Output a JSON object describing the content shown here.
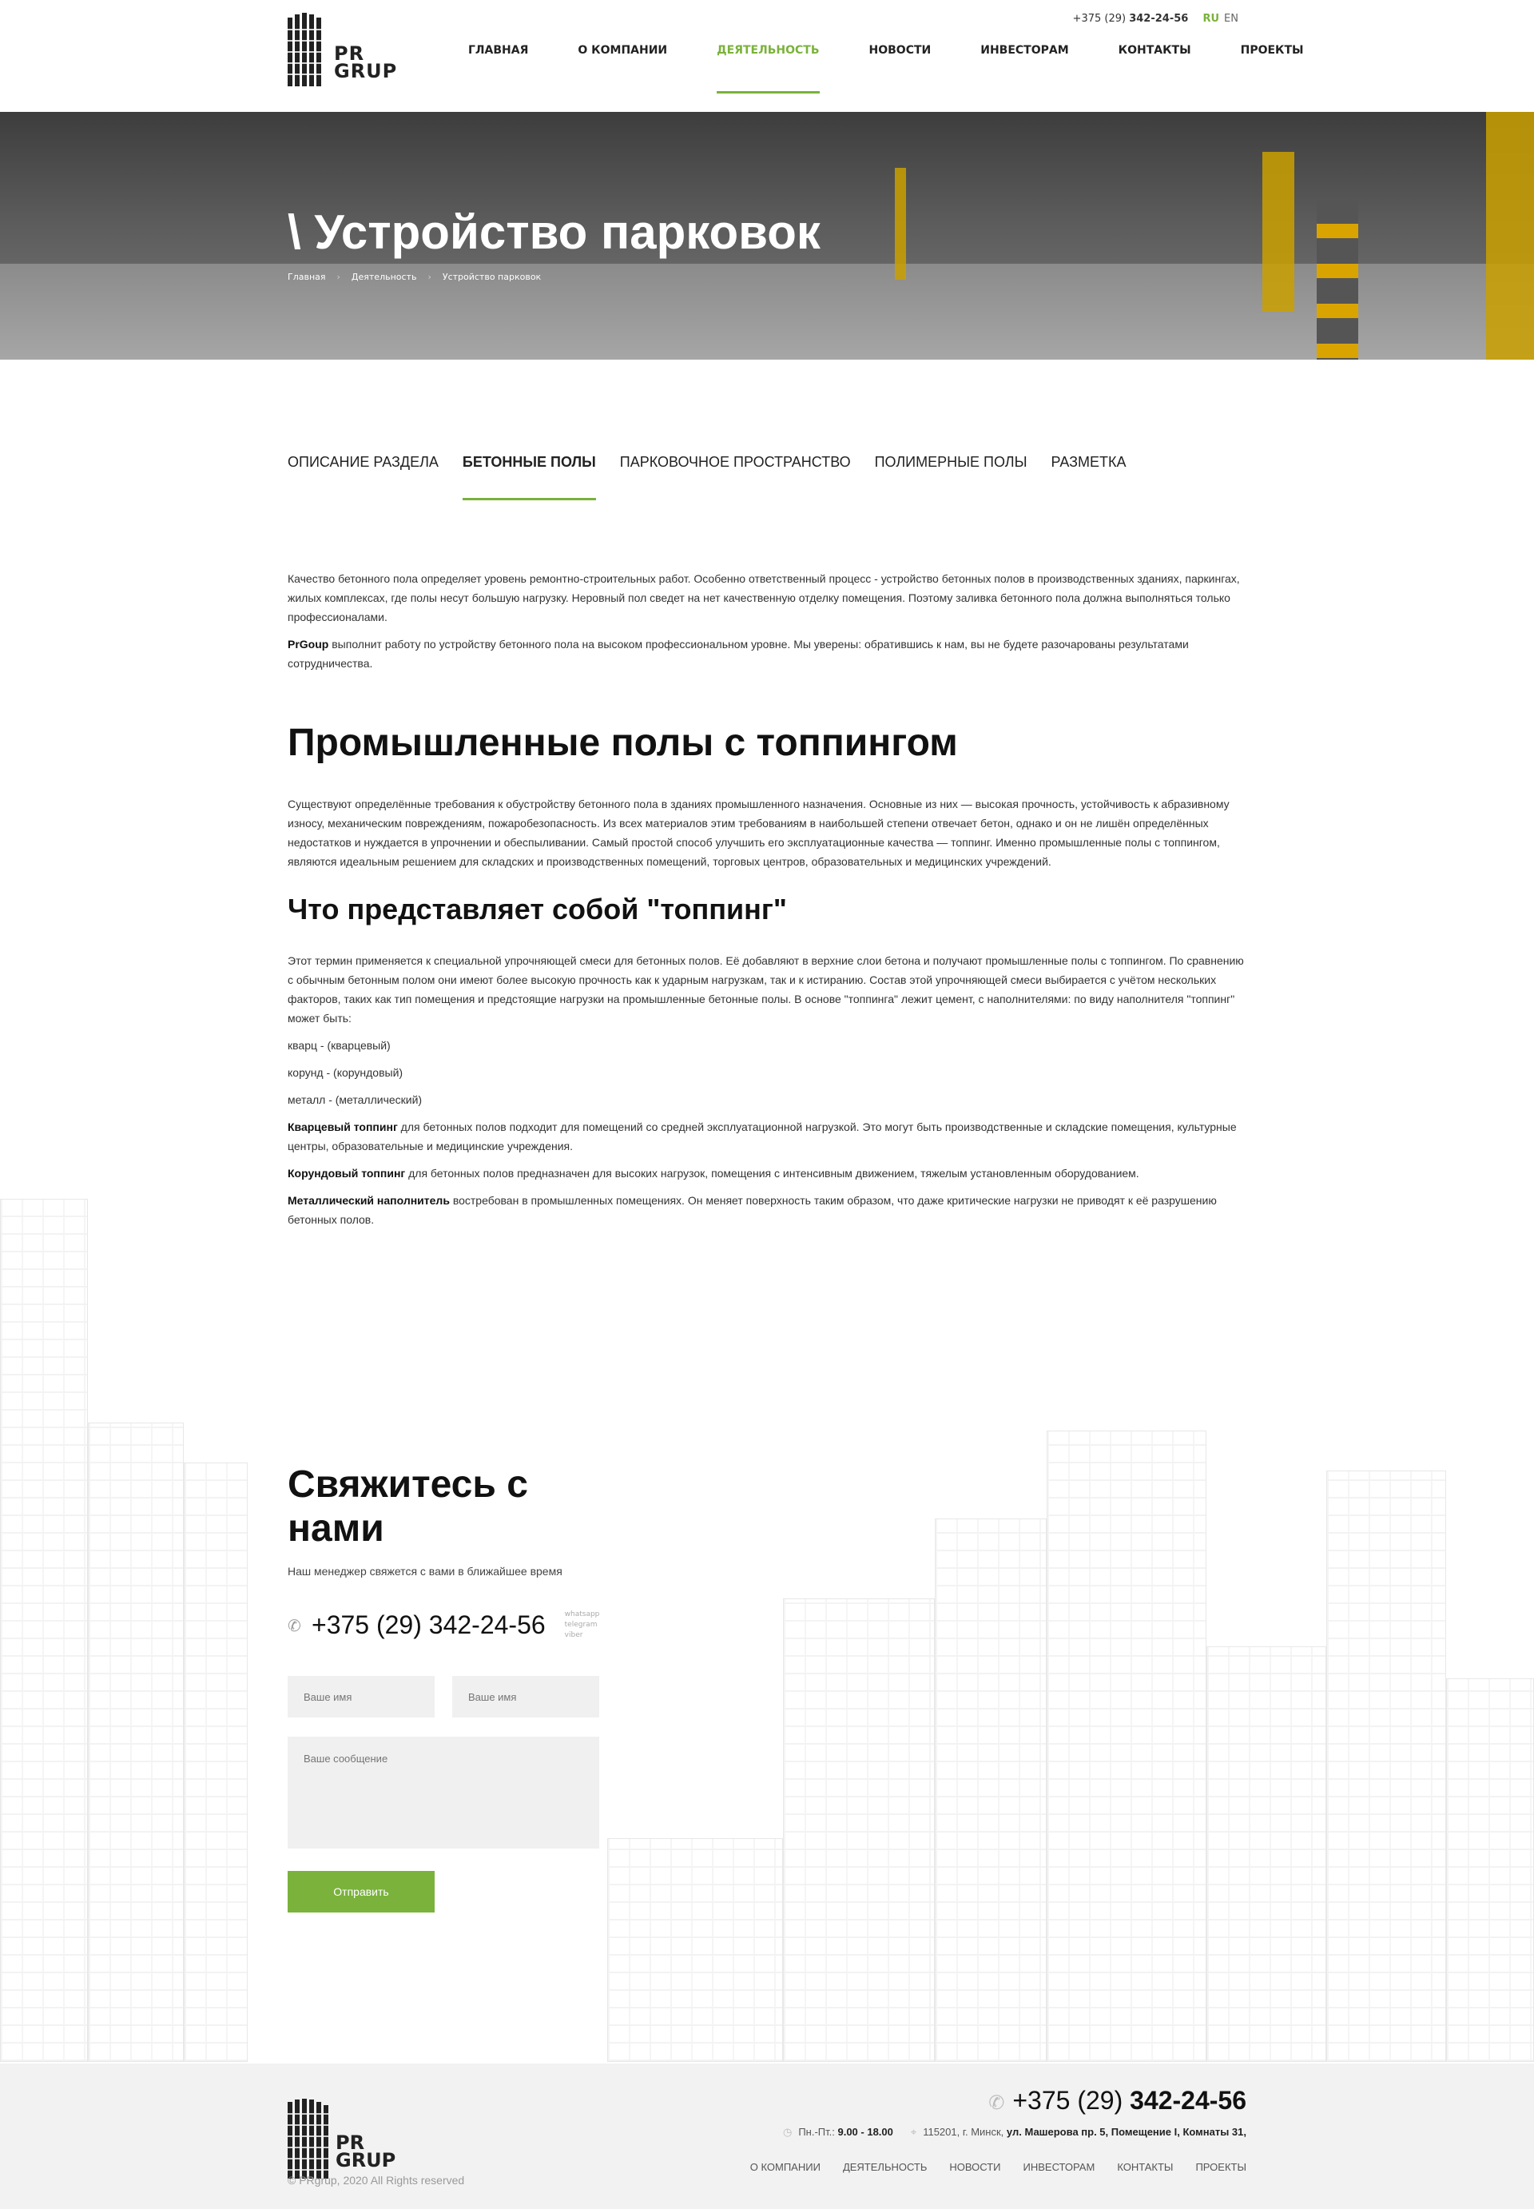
{
  "header": {
    "logo_text_1": "PR",
    "logo_text_2": "GRUP",
    "phone_prefix": "+375 (29)",
    "phone_number": "342-24-56",
    "lang_active": "RU",
    "lang_other": "EN",
    "nav": [
      "ГЛАВНАЯ",
      "О КОМПАНИИ",
      "ДЕЯТЕЛЬНОСТЬ",
      "НОВОСТИ",
      "ИНВЕСТОРАМ",
      "КОНТАКТЫ",
      "ПРОЕКТЫ"
    ],
    "accent": "#7ab23b"
  },
  "hero": {
    "title": "\\ Устройство парковок",
    "breadcrumb": [
      "Главная",
      "Деятельность",
      "Устройство парковок"
    ]
  },
  "tabs": [
    "ОПИСАНИЕ РАЗДЕЛА",
    "БЕТОННЫЕ ПОЛЫ",
    "ПАРКОВОЧНОЕ ПРОСТРАНСТВО",
    "ПОЛИМЕРНЫЕ ПОЛЫ",
    "РАЗМЕТКА"
  ],
  "content": {
    "intro_1": "Качество бетонного пола определяет уровень ремонтно-строительных работ. Особенно ответственный процесс - устройство бетонных полов в производственных зданиях, паркингах, жилых комплексах, где полы несут большую нагрузку. Неровный пол сведет на нет качественную отделку помещения. Поэтому заливка бетонного пола должна выполняться только профессионалами.",
    "intro_2_bold": "PrGoup",
    "intro_2": " выполнит работу по устройству бетонного пола на высоком профессиональном уровне. Мы уверены: обратившись к нам, вы не будете разочарованы результатами сотрудничества.",
    "h1": "Промышленные полы с топпингом",
    "p1": "Существуют определённые требования к обустройству бетонного пола в зданиях промышленного назначения. Основные из них — высокая прочность, устойчивость к абразивному износу, механическим повреждениям, пожаробезопасность. Из всех материалов этим требованиям в наибольшей степени отвечает бетон, однако и он не лишён определённых недостатков и нуждается в упрочнении и обеспыливании. Самый простой способ улучшить его эксплуатационные качества — топпинг. Именно промышленные полы с топпингом, являются идеальным решением для складских и производственных помещений, торговых центров, образовательных и медицинских учреждений.",
    "h2": "Что представляет собой \"топпинг\"",
    "p2": "Этот термин применяется к специальной упрочняющей смеси для бетонных полов. Её добавляют в верхние слои бетона и получают промышленные полы с топпингом. По сравнению с обычным бетонным полом они имеют более высокую прочность как к ударным нагрузкам, так и к истиранию. Состав этой упрочняющей смеси выбирается с учётом нескольких факторов, таких как тип помещения и предстоящие нагрузки на промышленные бетонные полы. В основе \"топпинга\" лежит цемент, с наполнителями: по виду наполнителя \"топпинг\" может быть:",
    "list": [
      "кварц - (кварцевый)",
      "корунд - (корундовый)",
      "металл - (металлический)"
    ],
    "q_bold": "Кварцевый топпинг",
    "q_text": " для бетонных полов подходит для помещений со средней эксплуатационной нагрузкой. Это могут быть производственные и складские помещения, культурные центры, образовательные и медицинские учреждения.",
    "c_bold": "Корундовый топпинг",
    "c_text": " для бетонных полов предназначен для высоких нагрузок, помещения с интенсивным движением, тяжелым установленным оборудованием.",
    "m_bold": "Металлический наполнитель",
    "m_text": "  востребован в промышленных помещениях. Он меняет поверхность таким образом, что даже критические нагрузки не приводят к её разрушению бетонных полов."
  },
  "contact": {
    "title": "Свяжитесь с нами",
    "subtitle": "Наш менеджер свяжется с вами в ближайшее время",
    "phone": "+375 (29) 342-24-56",
    "messengers": [
      "whatsapp",
      "telegram",
      "viber"
    ],
    "name_placeholder_1": "Ваше имя",
    "name_placeholder_2": "Ваше имя",
    "message_placeholder": "Ваше сообщение",
    "send_label": "Отправить"
  },
  "footer": {
    "logo_text_1": "PR",
    "logo_text_2": "GRUP",
    "phone_prefix": "+375 (29)",
    "phone_number": "342-24-56",
    "hours_label": "Пн.-Пт.:",
    "hours": "9.00 - 18.00",
    "address_prefix": "115201, г. Минск,",
    "address": "ул. Машерова пр. 5, Помещение I, Комнаты 31,",
    "nav": [
      "О КОМПАНИИ",
      "ДЕЯТЕЛЬНОСТЬ",
      "НОВОСТИ",
      "ИНВЕСТОРАМ",
      "КОНТАКТЫ",
      "ПРОЕКТЫ"
    ],
    "copyright": "© PRgrup, 2020 All Rights reserved"
  }
}
